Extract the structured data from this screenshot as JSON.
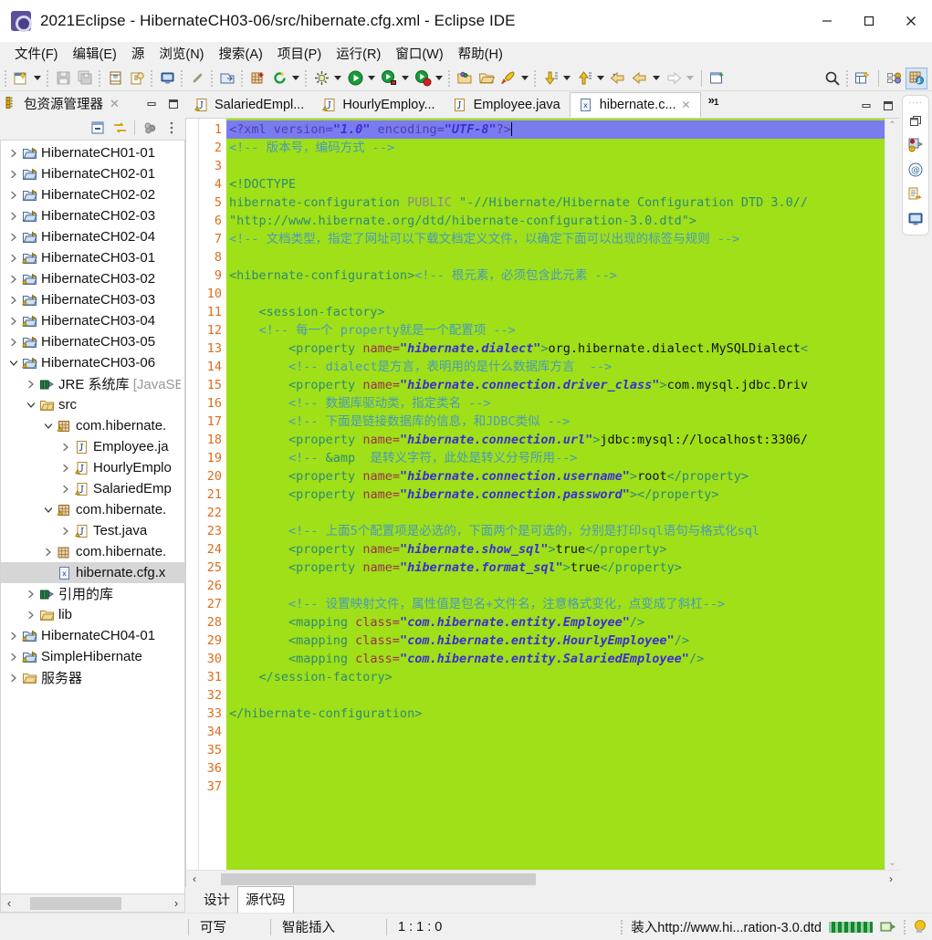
{
  "window": {
    "title": "2021Eclipse - HibernateCH03-06/src/hibernate.cfg.xml - Eclipse IDE",
    "app_icon": "eclipse-icon",
    "minimize": "minimize-button",
    "maximize": "maximize-button",
    "close": "close-button"
  },
  "menubar": {
    "items": [
      {
        "label": "文件(F)"
      },
      {
        "label": "编辑(E)"
      },
      {
        "label": "源"
      },
      {
        "label": "浏览(N)"
      },
      {
        "label": "搜索(A)"
      },
      {
        "label": "项目(P)"
      },
      {
        "label": "运行(R)"
      },
      {
        "label": "窗口(W)"
      },
      {
        "label": "帮助(H)"
      }
    ]
  },
  "toolbar": {
    "icons": [
      "new-wizard-icon",
      "save-icon",
      "save-all-icon",
      "export-icon",
      "print-icon",
      "console-icon",
      "link-icon",
      "open-type-icon",
      "new-java-package-icon",
      "refresh-icon",
      "debug-icon",
      "run-icon",
      "run-server-icon",
      "stop-server-icon",
      "open-folder-icon",
      "open-project-icon",
      "launch-icon",
      "next-annotation-icon",
      "previous-annotation-icon",
      "back-icon",
      "forward-icon",
      "new-window-icon",
      "search-icon",
      "new-perspective-icon",
      "java-perspective-icon",
      "javaee-perspective-icon"
    ]
  },
  "package_explorer": {
    "title": "包资源管理器",
    "close_label": "✕",
    "toolbar_icons": [
      "collapse-all-icon",
      "link-with-editor-icon",
      "view-menu-icon",
      "view-dots-icon"
    ],
    "minimize_label": "minimize",
    "maximize_label": "maximize",
    "tree": [
      {
        "label": "HibernateCH01-01",
        "icon": "project-folder-icon",
        "indent": 0,
        "twisty": "collapsed",
        "selected": false
      },
      {
        "label": "HibernateCH02-01",
        "icon": "project-folder-icon",
        "indent": 0,
        "twisty": "collapsed",
        "selected": false
      },
      {
        "label": "HibernateCH02-02",
        "icon": "project-folder-icon",
        "indent": 0,
        "twisty": "collapsed",
        "selected": false
      },
      {
        "label": "HibernateCH02-03",
        "icon": "project-folder-icon",
        "indent": 0,
        "twisty": "collapsed",
        "selected": false
      },
      {
        "label": "HibernateCH02-04",
        "icon": "project-folder-icon",
        "indent": 0,
        "twisty": "collapsed",
        "selected": false
      },
      {
        "label": "HibernateCH03-01",
        "icon": "project-warn-folder-icon",
        "indent": 0,
        "twisty": "collapsed",
        "selected": false
      },
      {
        "label": "HibernateCH03-02",
        "icon": "project-warn-folder-icon",
        "indent": 0,
        "twisty": "collapsed",
        "selected": false
      },
      {
        "label": "HibernateCH03-03",
        "icon": "project-warn-folder-icon",
        "indent": 0,
        "twisty": "collapsed",
        "selected": false
      },
      {
        "label": "HibernateCH03-04",
        "icon": "project-warn-folder-icon",
        "indent": 0,
        "twisty": "collapsed",
        "selected": false
      },
      {
        "label": "HibernateCH03-05",
        "icon": "project-warn-folder-icon",
        "indent": 0,
        "twisty": "collapsed",
        "selected": false
      },
      {
        "label": "HibernateCH03-06",
        "icon": "project-warn-folder-icon",
        "indent": 0,
        "twisty": "expanded",
        "selected": false
      },
      {
        "label": "JRE 系统库 [JavaSE",
        "icon": "library-icon",
        "indent": 1,
        "twisty": "collapsed",
        "selected": false,
        "muted_tail": true
      },
      {
        "label": "src",
        "icon": "source-folder-icon",
        "indent": 1,
        "twisty": "expanded",
        "selected": false
      },
      {
        "label": "com.hibernate.",
        "icon": "package-warn-icon",
        "indent": 2,
        "twisty": "expanded",
        "selected": false
      },
      {
        "label": "Employee.ja",
        "icon": "java-file-icon",
        "indent": 3,
        "twisty": "collapsed",
        "selected": false
      },
      {
        "label": "HourlyEmplo",
        "icon": "java-warn-file-icon",
        "indent": 3,
        "twisty": "collapsed",
        "selected": false
      },
      {
        "label": "SalariedEmp",
        "icon": "java-warn-file-icon",
        "indent": 3,
        "twisty": "collapsed",
        "selected": false
      },
      {
        "label": "com.hibernate.",
        "icon": "package-warn-icon",
        "indent": 2,
        "twisty": "expanded",
        "selected": false
      },
      {
        "label": "Test.java",
        "icon": "java-warn-file-icon",
        "indent": 3,
        "twisty": "collapsed",
        "selected": false
      },
      {
        "label": "com.hibernate.",
        "icon": "package-icon",
        "indent": 2,
        "twisty": "collapsed",
        "selected": false
      },
      {
        "label": "hibernate.cfg.x",
        "icon": "xml-file-icon",
        "indent": 2,
        "twisty": "none",
        "selected": true
      },
      {
        "label": "引用的库",
        "icon": "library-icon",
        "indent": 1,
        "twisty": "collapsed",
        "selected": false
      },
      {
        "label": "lib",
        "icon": "folder-icon",
        "indent": 1,
        "twisty": "collapsed",
        "selected": false
      },
      {
        "label": "HibernateCH04-01",
        "icon": "project-warn-folder-icon",
        "indent": 0,
        "twisty": "collapsed",
        "selected": false
      },
      {
        "label": "SimpleHibernate",
        "icon": "project-warn-folder-icon",
        "indent": 0,
        "twisty": "collapsed",
        "selected": false
      },
      {
        "label": "服务器",
        "icon": "folder-icon",
        "indent": 0,
        "twisty": "collapsed",
        "selected": false
      }
    ],
    "hscroll": {
      "left_arrow": "‹",
      "right_arrow": "›"
    }
  },
  "editor": {
    "tabs": [
      {
        "label": "SalariedEmpl...",
        "icon": "java-warn-file-icon",
        "active": false,
        "closable": false
      },
      {
        "label": "HourlyEmploy...",
        "icon": "java-warn-file-icon",
        "active": false,
        "closable": false
      },
      {
        "label": "Employee.java",
        "icon": "java-file-icon",
        "active": false,
        "closable": false
      },
      {
        "label": "hibernate.c...",
        "icon": "xml-file-icon",
        "active": true,
        "closable": true,
        "close_label": "✕"
      }
    ],
    "overflow_chevron": "»",
    "overflow_count": "1",
    "minimize_label": "minimize",
    "maximize_label": "maximize",
    "bottom_tabs": [
      {
        "label": "设计",
        "active": false
      },
      {
        "label": "源代码",
        "active": true
      }
    ],
    "line_numbers": [
      "1",
      "2",
      "3",
      "4",
      "5",
      "6",
      "7",
      "8",
      "9",
      "10",
      "11",
      "12",
      "13",
      "14",
      "15",
      "16",
      "17",
      "18",
      "19",
      "20",
      "21",
      "22",
      "23",
      "24",
      "25",
      "26",
      "27",
      "28",
      "29",
      "30",
      "31",
      "32",
      "33",
      "34",
      "35",
      "36",
      "37"
    ],
    "code_lines": [
      {
        "n": 1,
        "current": true,
        "segments": [
          {
            "t": "<?xml ",
            "c": "proc"
          },
          {
            "t": "version=",
            "c": "proc"
          },
          {
            "t": "\"1.0\"",
            "c": "val"
          },
          {
            "t": " encoding=",
            "c": "proc"
          },
          {
            "t": "\"UTF-8\"",
            "c": "val"
          },
          {
            "t": "?>",
            "c": "proc"
          }
        ]
      },
      {
        "n": 2,
        "current": false,
        "segments": [
          {
            "t": "<!-- 版本号，编码方式 -->",
            "c": "cmt"
          }
        ]
      },
      {
        "n": 3,
        "current": false,
        "segments": []
      },
      {
        "n": 4,
        "current": false,
        "segments": [
          {
            "t": "<!DOCTYPE",
            "c": "dt"
          }
        ]
      },
      {
        "n": 5,
        "current": false,
        "segments": [
          {
            "t": "hibernate-configuration ",
            "c": "dt"
          },
          {
            "t": "PUBLIC ",
            "c": "pub"
          },
          {
            "t": "\"-//Hibernate/Hibernate Configuration DTD 3.0//",
            "c": "dt"
          }
        ]
      },
      {
        "n": 6,
        "current": false,
        "segments": [
          {
            "t": "\"http://www.hibernate.org/dtd/hibernate-configuration-3.0.dtd\">",
            "c": "dt"
          }
        ]
      },
      {
        "n": 7,
        "current": false,
        "segments": [
          {
            "t": "<!-- 文档类型，指定了网址可以下载文档定义文件，以确定下面可以出现的标签与规则 -->",
            "c": "cmt"
          }
        ]
      },
      {
        "n": 8,
        "current": false,
        "segments": []
      },
      {
        "n": 9,
        "current": false,
        "segments": [
          {
            "t": "<hibernate-configuration>",
            "c": "tag"
          },
          {
            "t": "<!-- 根元素，必须包含此元素 -->",
            "c": "cmt"
          }
        ]
      },
      {
        "n": 10,
        "current": false,
        "segments": []
      },
      {
        "n": 11,
        "current": false,
        "segments": [
          {
            "t": "    <session-factory>",
            "c": "tag"
          }
        ]
      },
      {
        "n": 12,
        "current": false,
        "segments": [
          {
            "t": "    <!-- 每一个 property就是一个配置项 -->",
            "c": "cmt"
          }
        ]
      },
      {
        "n": 13,
        "current": false,
        "segments": [
          {
            "t": "        <property ",
            "c": "tag"
          },
          {
            "t": "name=",
            "c": "attr"
          },
          {
            "t": "\"hibernate.dialect\"",
            "c": "val"
          },
          {
            "t": ">",
            "c": "tag"
          },
          {
            "t": "org.hibernate.dialect.MySQLDialect",
            "c": "txt"
          },
          {
            "t": "<",
            "c": "tag"
          }
        ]
      },
      {
        "n": 14,
        "current": false,
        "segments": [
          {
            "t": "        <!-- dialect是方言，表明用的是什么数据库方言  -->",
            "c": "cmt"
          }
        ]
      },
      {
        "n": 15,
        "current": false,
        "segments": [
          {
            "t": "        <property ",
            "c": "tag"
          },
          {
            "t": "name=",
            "c": "attr"
          },
          {
            "t": "\"hibernate.connection.driver_class\"",
            "c": "val"
          },
          {
            "t": ">",
            "c": "tag"
          },
          {
            "t": "com.mysql.jdbc.Driv",
            "c": "txt"
          }
        ]
      },
      {
        "n": 16,
        "current": false,
        "segments": [
          {
            "t": "        <!-- 数据库驱动类，指定类名 -->",
            "c": "cmt"
          }
        ]
      },
      {
        "n": 17,
        "current": false,
        "segments": [
          {
            "t": "        <!-- 下面是链接数据库的信息，和JDBC类似 -->",
            "c": "cmt"
          }
        ]
      },
      {
        "n": 18,
        "current": false,
        "segments": [
          {
            "t": "        <property ",
            "c": "tag"
          },
          {
            "t": "name=",
            "c": "attr"
          },
          {
            "t": "\"hibernate.connection.url\"",
            "c": "val"
          },
          {
            "t": ">",
            "c": "tag"
          },
          {
            "t": "jdbc:mysql://localhost:3306/",
            "c": "txt"
          }
        ]
      },
      {
        "n": 19,
        "current": false,
        "segments": [
          {
            "t": "        <!-- ",
            "c": "cmt"
          },
          {
            "t": "&amp",
            "c": "tag"
          },
          {
            "t": "  是转义字符，此处是转义分号所用-->",
            "c": "cmt"
          }
        ]
      },
      {
        "n": 20,
        "current": false,
        "segments": [
          {
            "t": "        <property ",
            "c": "tag"
          },
          {
            "t": "name=",
            "c": "attr"
          },
          {
            "t": "\"hibernate.connection.username\"",
            "c": "val"
          },
          {
            "t": ">",
            "c": "tag"
          },
          {
            "t": "root",
            "c": "txt"
          },
          {
            "t": "</property>",
            "c": "tag"
          }
        ]
      },
      {
        "n": 21,
        "current": false,
        "segments": [
          {
            "t": "        <property ",
            "c": "tag"
          },
          {
            "t": "name=",
            "c": "attr"
          },
          {
            "t": "\"hibernate.connection.password\"",
            "c": "val"
          },
          {
            "t": ">",
            "c": "tag"
          },
          {
            "t": "</property>",
            "c": "tag"
          }
        ]
      },
      {
        "n": 22,
        "current": false,
        "segments": []
      },
      {
        "n": 23,
        "current": false,
        "segments": [
          {
            "t": "        <!-- 上面5个配置项是必选的，下面两个是可选的，分别是打印sql语句与格式化sql",
            "c": "cmt"
          }
        ]
      },
      {
        "n": 24,
        "current": false,
        "segments": [
          {
            "t": "        <property ",
            "c": "tag"
          },
          {
            "t": "name=",
            "c": "attr"
          },
          {
            "t": "\"hibernate.show_sql\"",
            "c": "val"
          },
          {
            "t": ">",
            "c": "tag"
          },
          {
            "t": "true",
            "c": "txt"
          },
          {
            "t": "</property>",
            "c": "tag"
          }
        ]
      },
      {
        "n": 25,
        "current": false,
        "segments": [
          {
            "t": "        <property ",
            "c": "tag"
          },
          {
            "t": "name=",
            "c": "attr"
          },
          {
            "t": "\"hibernate.format_sql\"",
            "c": "val"
          },
          {
            "t": ">",
            "c": "tag"
          },
          {
            "t": "true",
            "c": "txt"
          },
          {
            "t": "</property>",
            "c": "tag"
          }
        ]
      },
      {
        "n": 26,
        "current": false,
        "segments": []
      },
      {
        "n": 27,
        "current": false,
        "segments": [
          {
            "t": "        <!-- 设置映射文件，属性值是包名+文件名，注意格式变化，点变成了斜杠-->",
            "c": "cmt"
          }
        ]
      },
      {
        "n": 28,
        "current": false,
        "segments": [
          {
            "t": "        <mapping ",
            "c": "tag"
          },
          {
            "t": "class=",
            "c": "attr"
          },
          {
            "t": "\"com.hibernate.entity.Employee\"",
            "c": "val"
          },
          {
            "t": "/>",
            "c": "tag"
          }
        ]
      },
      {
        "n": 29,
        "current": false,
        "segments": [
          {
            "t": "        <mapping ",
            "c": "tag"
          },
          {
            "t": "class=",
            "c": "attr"
          },
          {
            "t": "\"com.hibernate.entity.HourlyEmployee\"",
            "c": "val"
          },
          {
            "t": "/>",
            "c": "tag"
          }
        ]
      },
      {
        "n": 30,
        "current": false,
        "segments": [
          {
            "t": "        <mapping ",
            "c": "tag"
          },
          {
            "t": "class=",
            "c": "attr"
          },
          {
            "t": "\"com.hibernate.entity.SalariedEmployee\"",
            "c": "val"
          },
          {
            "t": "/>",
            "c": "tag"
          }
        ]
      },
      {
        "n": 31,
        "current": false,
        "segments": [
          {
            "t": "    </session-factory>",
            "c": "tag"
          }
        ]
      },
      {
        "n": 32,
        "current": false,
        "segments": []
      },
      {
        "n": 33,
        "current": false,
        "segments": [
          {
            "t": "</hibernate-configuration>",
            "c": "tag"
          }
        ]
      },
      {
        "n": 34,
        "current": false,
        "segments": []
      },
      {
        "n": 35,
        "current": false,
        "segments": []
      },
      {
        "n": 36,
        "current": false,
        "segments": []
      },
      {
        "n": 37,
        "current": false,
        "segments": []
      }
    ],
    "scroll": {
      "up_arrow": "⌃",
      "left_arrow": "‹",
      "right_arrow": "›"
    }
  },
  "right_bar": {
    "icons": [
      "restore-icon",
      "servers-view-icon",
      "at-view-icon",
      "outline-view-icon",
      "console-view-icon"
    ],
    "dots": "····"
  },
  "statusbar": {
    "writable": "可写",
    "insert_mode": "智能插入",
    "position": "1 : 1 : 0",
    "task": "装入http://www.hi...ration-3.0.dtd",
    "progress_icon": "progress-bar",
    "background_tasks_icon": "background-operations-icon",
    "tip_icon": "tip-bulb-icon"
  },
  "colors": {
    "editor_background": "#9fe018",
    "current_line": "#7b7bf0",
    "line_number": "#e06c1a",
    "tag": "#2e8b72",
    "attribute": "#9c2f4f",
    "value": "#3b2fd0",
    "comment": "#4a9ab8",
    "text": "#111111",
    "chrome": "#f0f0f0",
    "selection": "#d6d6d6"
  }
}
